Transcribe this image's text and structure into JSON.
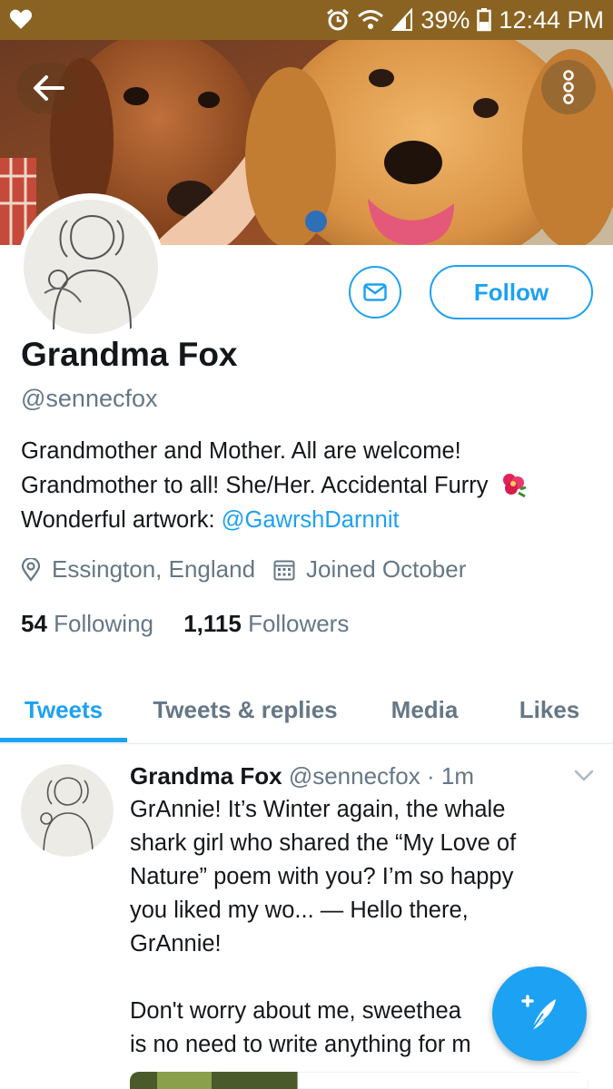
{
  "status_bar": {
    "battery": "39%",
    "time": "12:44 PM",
    "background": "#8a6322"
  },
  "profile": {
    "display_name": "Grandma Fox",
    "handle": "@sennecfox",
    "follow_label": "Follow",
    "bio_lines": [
      "Grandmother and Mother. All are welcome!",
      "Grandmother to all! She/Her. Accidental Furry",
      "Wonderful artwork: "
    ],
    "bio_link": "@GawrshDarnnit",
    "location": "Essington, England",
    "joined": "Joined October",
    "following_count": "54",
    "following_label": "Following",
    "followers_count": "1,115",
    "followers_label": "Followers"
  },
  "tabs": [
    {
      "label": "Tweets",
      "active": true
    },
    {
      "label": "Tweets & replies",
      "active": false
    },
    {
      "label": "Media",
      "active": false
    },
    {
      "label": "Likes",
      "active": false
    }
  ],
  "tweet": {
    "author": "Grandma Fox",
    "handle": "@sennecfox",
    "time": "· 1m",
    "lines": [
      "GrAnnie! It’s Winter again, the whale",
      "shark girl who shared the “My Love of",
      "Nature” poem with you? I’m so happy",
      "you liked my wo... — Hello there,",
      "GrAnnie!",
      "",
      "Don't worry about me, sweethea",
      "is no need to write anything for m"
    ]
  },
  "colors": {
    "accent": "#1da1f2",
    "secondary_text": "#657786",
    "primary_text": "#14171a"
  },
  "icons": [
    "heart-icon",
    "alarm-icon",
    "wifi-icon",
    "signal-icon",
    "battery-icon",
    "back-arrow-icon",
    "more-icon",
    "envelope-icon",
    "location-icon",
    "calendar-icon",
    "chevron-down-icon",
    "compose-icon",
    "flower-emoji-icon"
  ]
}
